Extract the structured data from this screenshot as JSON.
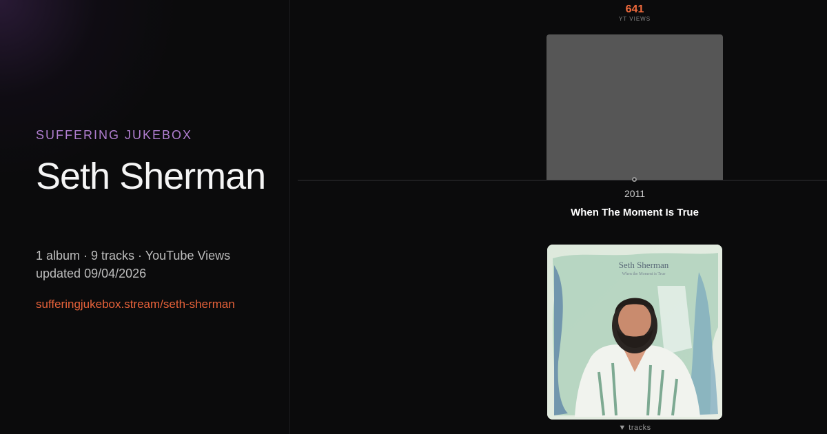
{
  "brand": "SUFFERING JUKEBOX",
  "artist": "Seth Sherman",
  "meta": {
    "line1": "1 album · 9 tracks · YouTube Views",
    "line2": "updated 09/04/2026"
  },
  "url": "sufferingjukebox.stream/seth-sherman",
  "chart": {
    "views": "641",
    "views_label": "YT VIEWS",
    "year": "2011",
    "album_title": "When The Moment Is True",
    "bar_fill": 1.0
  },
  "cover": {
    "artist_text": "Seth Sherman",
    "subtitle_text": "When the Moment is True"
  },
  "tracks_toggle": "▼ tracks",
  "colors": {
    "accent": "#e8623a",
    "brand": "#b07ed0",
    "bar": "#565656",
    "background": "#0b0b0c"
  }
}
